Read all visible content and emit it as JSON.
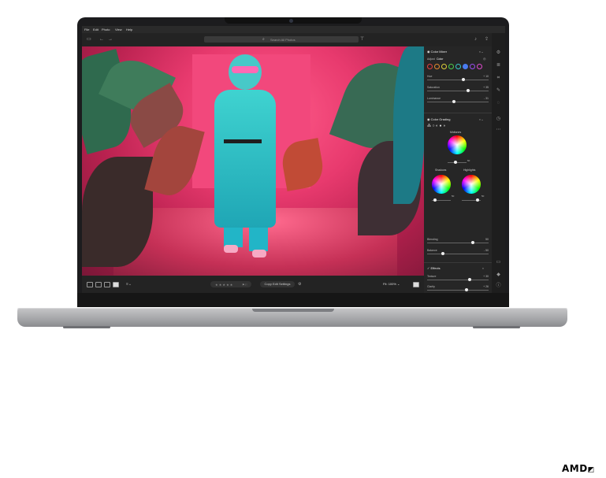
{
  "menu": [
    "File",
    "Edit",
    "Photo",
    "View",
    "Help"
  ],
  "search": {
    "placeholder": "Search All Photos"
  },
  "panel": {
    "color_mixer": {
      "title": "Color Mixer",
      "adjust_label": "Adjust",
      "adjust_value": "Color",
      "sliders": [
        {
          "label": "Hue",
          "value": "+ 10"
        },
        {
          "label": "Saturation",
          "value": "+ 35"
        },
        {
          "label": "Luminance",
          "value": "- 31"
        }
      ]
    },
    "color_grading": {
      "title": "Color Grading",
      "midtones_label": "Midtones",
      "shadows_label": "Shadows",
      "highlights_label": "Highlights",
      "midtones_value": "50",
      "shadows_value": "50",
      "highlights_value": "50",
      "sliders": [
        {
          "label": "Blending",
          "value": "50"
        },
        {
          "label": "Balance",
          "value": "- 50"
        }
      ]
    },
    "effects": {
      "title": "Effects",
      "sliders": [
        {
          "label": "Texture",
          "value": "+ 30"
        },
        {
          "label": "Clarity",
          "value": "+ 26"
        },
        {
          "label": "Dehaze",
          "value": "- 41"
        }
      ]
    }
  },
  "bottombar": {
    "rating": "★ ★ ★ ★ ★",
    "copy_button": "Copy Edit Settings",
    "fit_label": "Fit",
    "zoom": "100%"
  },
  "brand": {
    "logo_text": "AMD"
  },
  "colors": {
    "backdrop_pink": "#e83a6e",
    "panel_bg": "#262626",
    "toolbar_bg": "#232323",
    "chassis": "#a7a8ab"
  }
}
